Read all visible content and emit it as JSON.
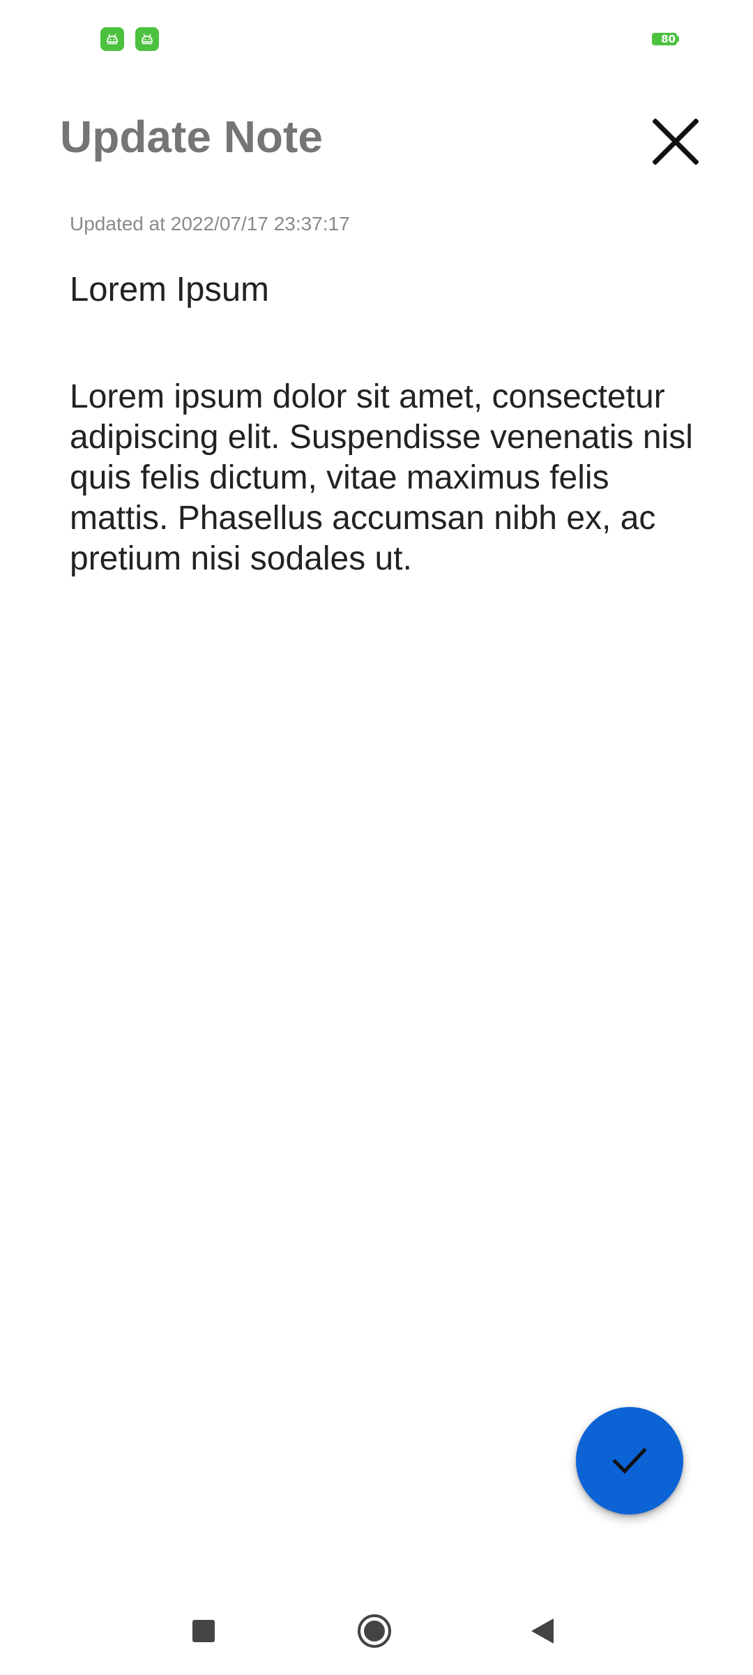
{
  "status_bar": {
    "battery_level": "80",
    "app_icons": [
      "android-app-icon",
      "android-app-icon"
    ],
    "accent_color": "#4cc13f"
  },
  "header": {
    "title": "Update Note",
    "close_icon": "close-icon"
  },
  "note": {
    "updated_at": "Updated at 2022/07/17 23:37:17",
    "title": "Lorem Ipsum",
    "body": "Lorem ipsum dolor sit amet, consectetur adipiscing elit. Suspendisse venenatis nisl quis felis dictum, vitae maximus felis mattis. Phasellus accumsan nibh ex, ac pretium nisi sodales ut."
  },
  "fab": {
    "icon": "check-icon",
    "color": "#0b63d6"
  },
  "nav_bar": {
    "buttons": [
      "recents-icon",
      "home-icon",
      "back-icon"
    ]
  }
}
